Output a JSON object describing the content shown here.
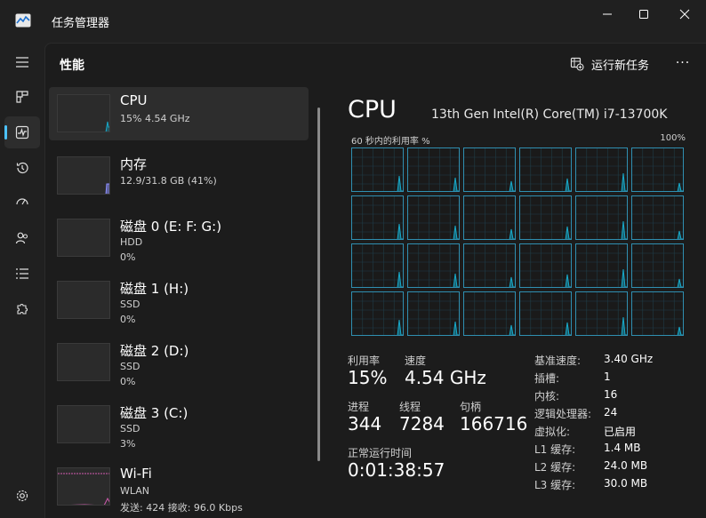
{
  "app": {
    "title": "任务管理器"
  },
  "header": {
    "page_title": "性能",
    "run_task_label": "运行新任务",
    "more_label": "···"
  },
  "devices": [
    {
      "name": "CPU",
      "line1": "15%  4.54 GHz",
      "line2": "",
      "kind": "cpu"
    },
    {
      "name": "内存",
      "line1": "12.9/31.8 GB (41%)",
      "line2": "",
      "kind": "mem"
    },
    {
      "name": "磁盘 0 (E: F: G:)",
      "line1": "HDD",
      "line2": "0%",
      "kind": "disk"
    },
    {
      "name": "磁盘 1 (H:)",
      "line1": "SSD",
      "line2": "0%",
      "kind": "disk"
    },
    {
      "name": "磁盘 2 (D:)",
      "line1": "SSD",
      "line2": "0%",
      "kind": "disk"
    },
    {
      "name": "磁盘 3 (C:)",
      "line1": "SSD",
      "line2": "3%",
      "kind": "disk"
    },
    {
      "name": "Wi-Fi",
      "line1": "WLAN",
      "line2": "发送: 424  接收: 96.0 Kbps",
      "kind": "wifi"
    }
  ],
  "cpu": {
    "title": "CPU",
    "model": "13th Gen Intel(R) Core(TM) i7-13700K",
    "graph_label_left": "60 秒内的利用率 %",
    "graph_label_right": "100%",
    "stats": {
      "util_label": "利用率",
      "util_value": "15%",
      "speed_label": "速度",
      "speed_value": "4.54 GHz",
      "proc_label": "进程",
      "proc_value": "344",
      "thread_label": "线程",
      "thread_value": "7284",
      "handle_label": "句柄",
      "handle_value": "166716",
      "uptime_label": "正常运行时间",
      "uptime_value": "0:01:38:57"
    },
    "specs": [
      {
        "label": "基准速度:",
        "value": "3.40 GHz"
      },
      {
        "label": "插槽:",
        "value": "1"
      },
      {
        "label": "内核:",
        "value": "16"
      },
      {
        "label": "逻辑处理器:",
        "value": "24"
      },
      {
        "label": "虚拟化:",
        "value": "已启用"
      },
      {
        "label": "L1 缓存:",
        "value": "1.4 MB"
      },
      {
        "label": "L2 缓存:",
        "value": "24.0 MB"
      },
      {
        "label": "L3 缓存:",
        "value": "30.0 MB"
      }
    ]
  },
  "colors": {
    "accent": "#4cc2ff",
    "cpu_line": "#17a9c9",
    "mem_line": "#8c8fff",
    "wifi_line": "#d35bb1",
    "grid_border": "#2f8fb1"
  }
}
